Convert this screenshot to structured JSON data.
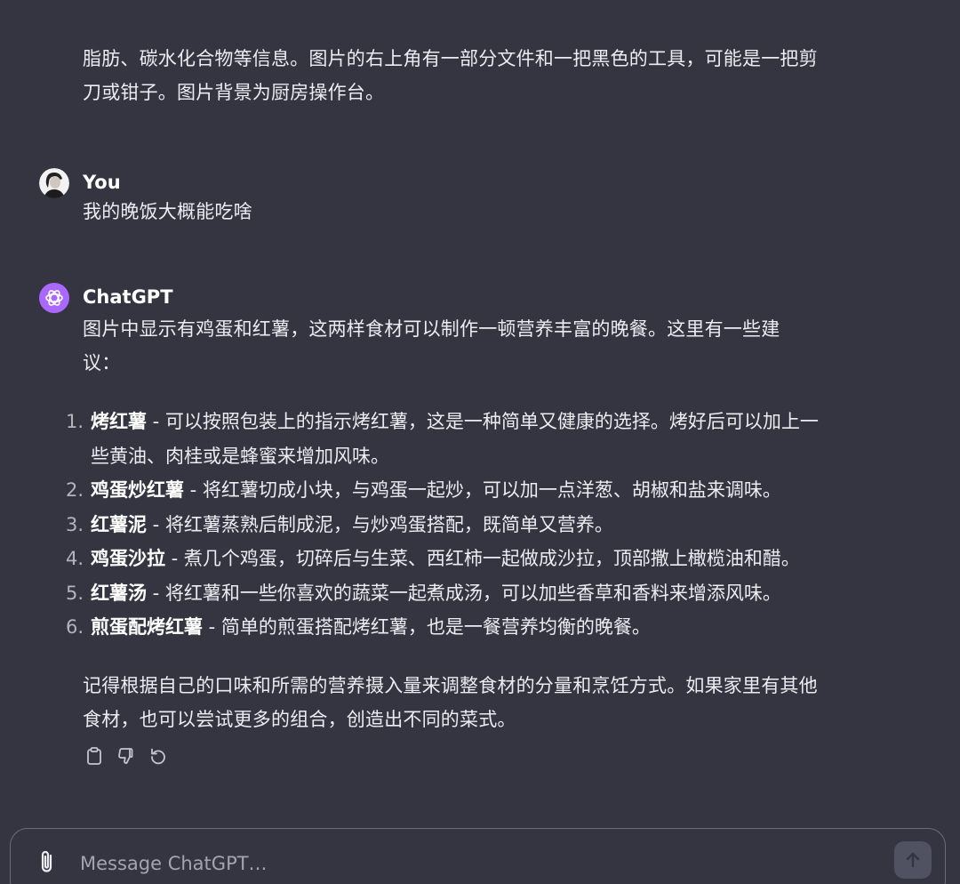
{
  "conversation": {
    "previous_reply_tail": "脂肪、碳水化合物等信息。图片的右上角有一部分文件和一把黑色的工具，可能是一把剪刀或钳子。图片背景为厨房操作台。",
    "user_message": {
      "author": "You",
      "text": "我的晚饭大概能吃啥"
    },
    "assistant_message": {
      "author": "ChatGPT",
      "intro": "图片中显示有鸡蛋和红薯，这两样食材可以制作一顿营养丰富的晚餐。这里有一些建议：",
      "suggestions": [
        {
          "num": "1.",
          "name": "烤红薯",
          "desc": " - 可以按照包装上的指示烤红薯，这是一种简单又健康的选择。烤好后可以加上一些黄油、肉桂或是蜂蜜来增加风味。"
        },
        {
          "num": "2.",
          "name": "鸡蛋炒红薯",
          "desc": " - 将红薯切成小块，与鸡蛋一起炒，可以加一点洋葱、胡椒和盐来调味。"
        },
        {
          "num": "3.",
          "name": "红薯泥",
          "desc": " - 将红薯蒸熟后制成泥，与炒鸡蛋搭配，既简单又营养。"
        },
        {
          "num": "4.",
          "name": "鸡蛋沙拉",
          "desc": " - 煮几个鸡蛋，切碎后与生菜、西红柿一起做成沙拉，顶部撒上橄榄油和醋。"
        },
        {
          "num": "5.",
          "name": "红薯汤",
          "desc": " - 将红薯和一些你喜欢的蔬菜一起煮成汤，可以加些香草和香料来增添风味。"
        },
        {
          "num": "6.",
          "name": "煎蛋配烤红薯",
          "desc": " - 简单的煎蛋搭配烤红薯，也是一餐营养均衡的晚餐。"
        }
      ],
      "outro": "记得根据自己的口味和所需的营养摄入量来调整食材的分量和烹饪方式。如果家里有其他食材，也可以尝试更多的组合，创造出不同的菜式。"
    }
  },
  "composer": {
    "placeholder": "Message ChatGPT…",
    "value": ""
  },
  "icons": {
    "copy": "clipboard-icon",
    "dislike": "thumbs-down-icon",
    "regenerate": "regenerate-icon",
    "attach": "paperclip-icon",
    "send": "arrow-up-icon"
  },
  "colors": {
    "background": "#343541",
    "text": "#ececf1",
    "assistant_avatar": "#ab68ff",
    "send_button": "#505161"
  }
}
